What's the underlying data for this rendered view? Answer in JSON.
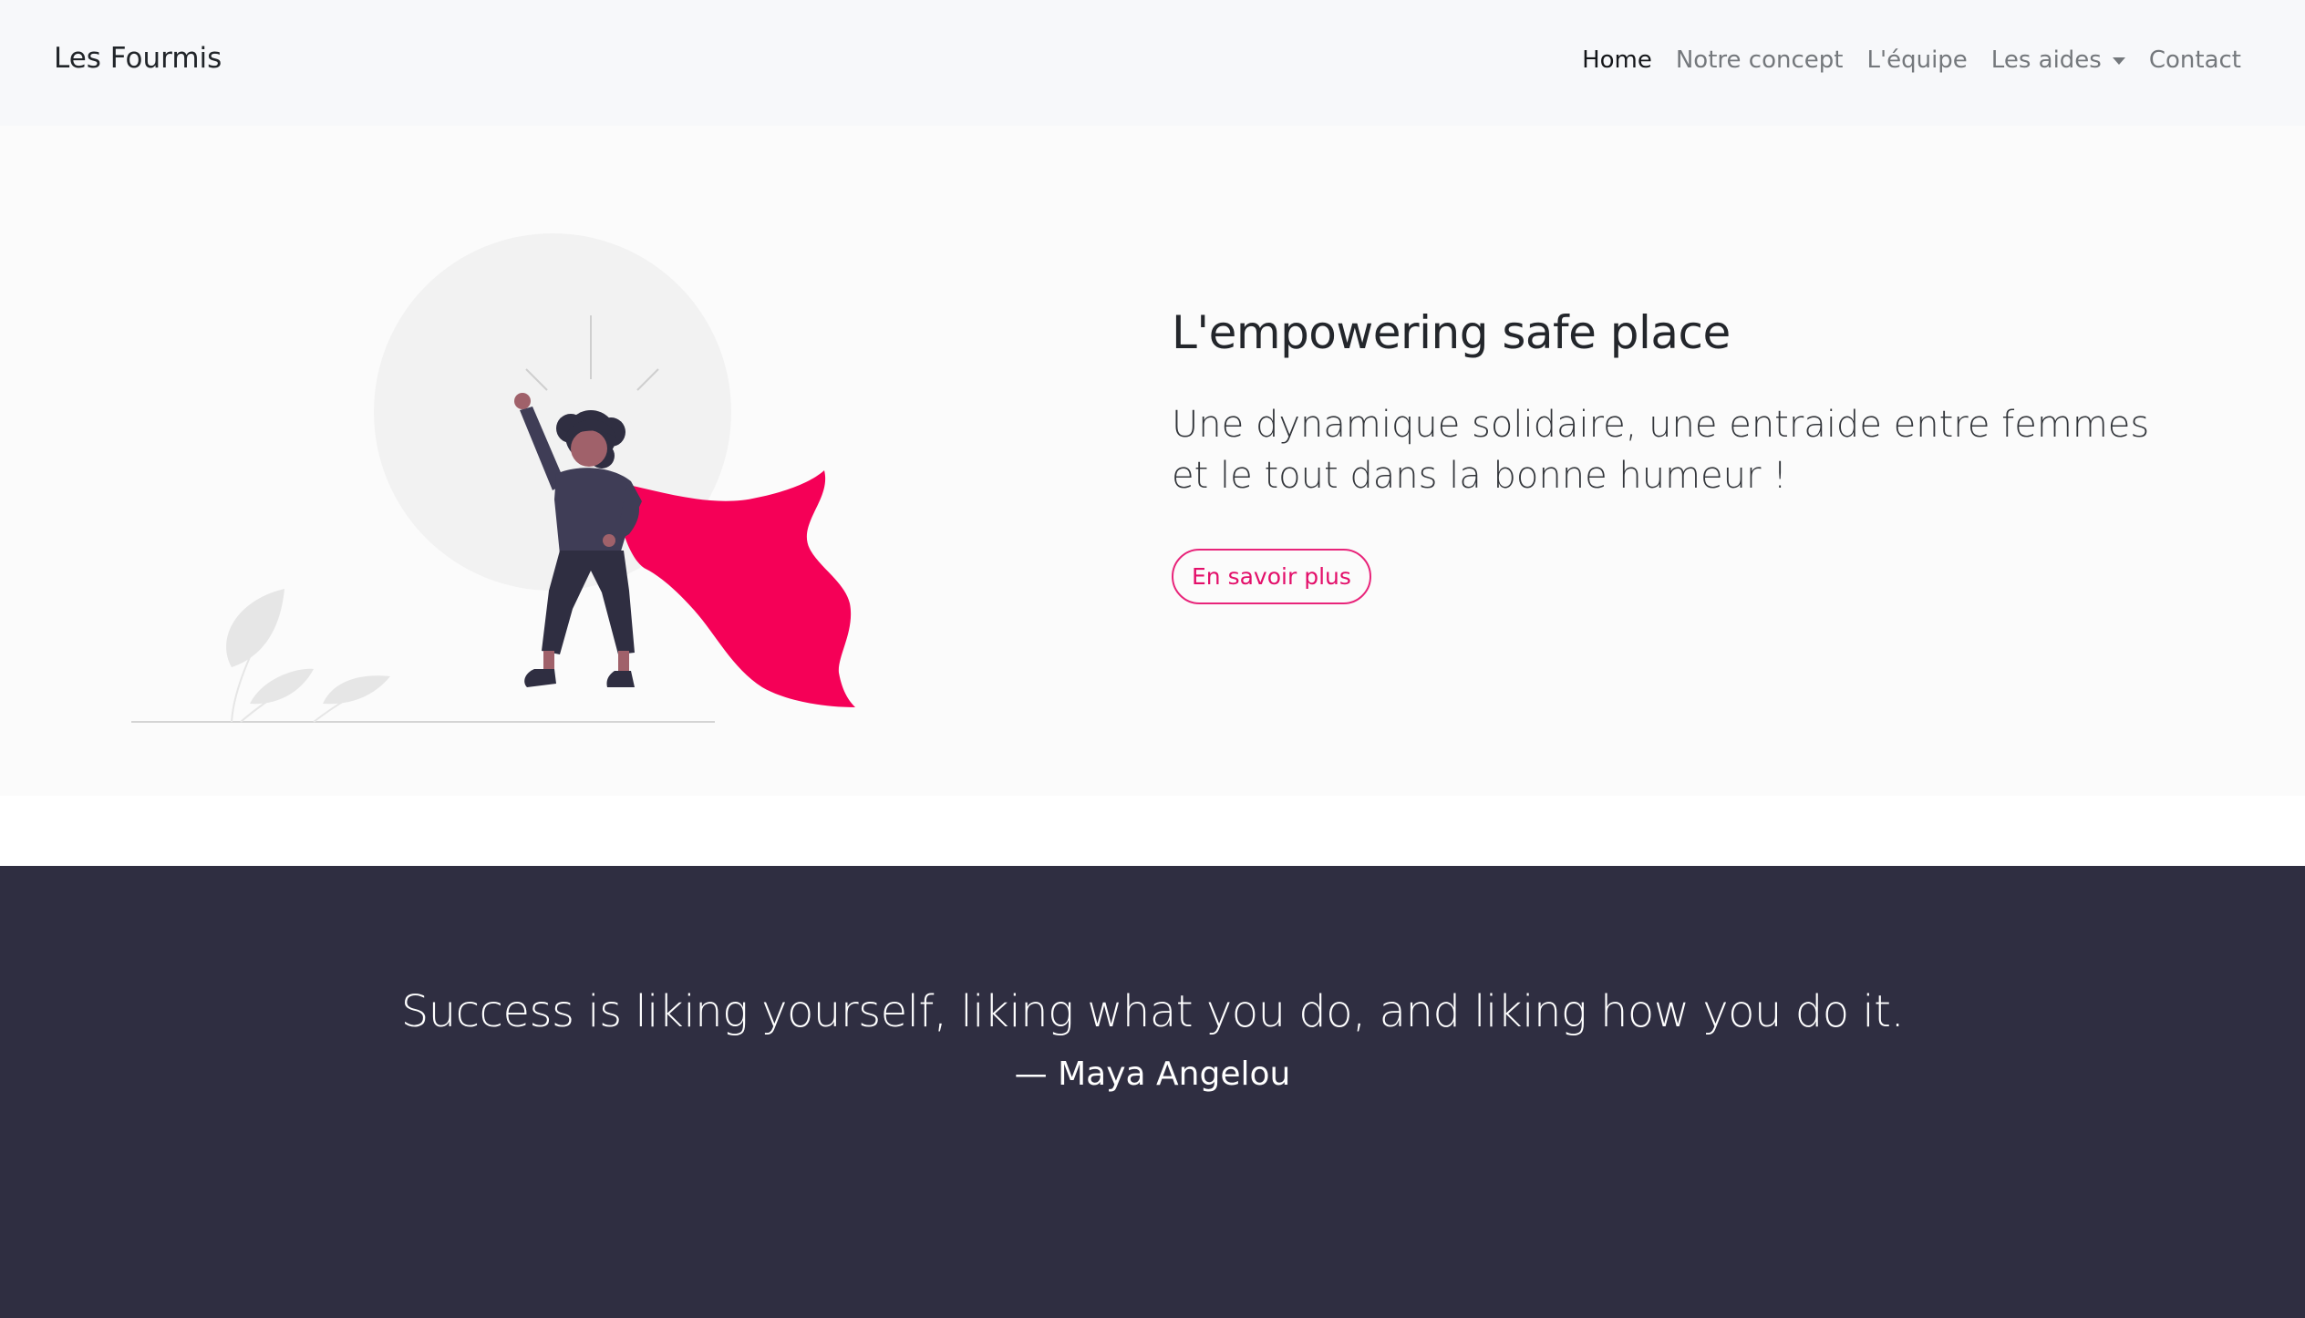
{
  "navbar": {
    "brand": "Les Fourmis",
    "links": [
      {
        "label": "Home",
        "active": true
      },
      {
        "label": "Notre concept"
      },
      {
        "label": "L'équipe"
      },
      {
        "label": "Les aides",
        "dropdown": true
      },
      {
        "label": "Contact"
      }
    ]
  },
  "hero": {
    "title": "L'empowering safe place",
    "lead": "Une dynamique solidaire, une entraide entre femmes et le tout dans la bonne humeur !",
    "button_label": "En savoir plus",
    "illustration": "superhero-woman-with-red-cape"
  },
  "quote": {
    "text": "Success is liking yourself, liking what you do, and liking how you do it.",
    "author": "— Maya Angelou"
  },
  "colors": {
    "navbar_bg": "#f7f8fa",
    "hero_bg": "#fbfbfb",
    "accent": "#f50057",
    "quote_bg": "#2f2e41",
    "text_dark": "#212529",
    "nav_muted": "#74787c"
  }
}
